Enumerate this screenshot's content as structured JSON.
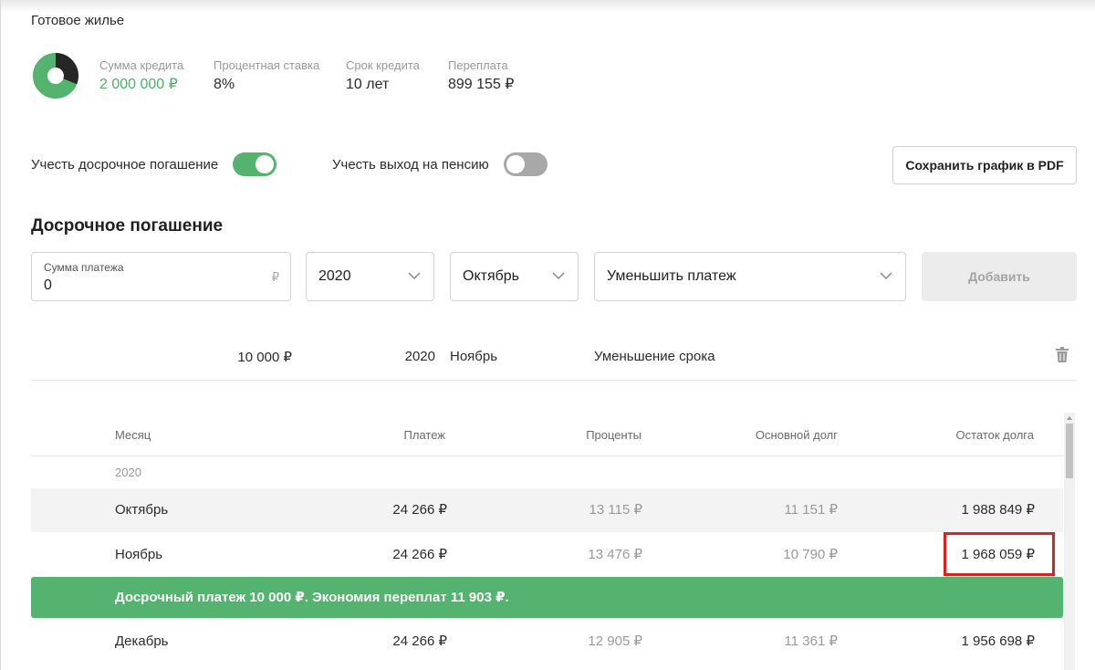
{
  "header": {
    "title": "Готовое жилье"
  },
  "summary": {
    "donut": {
      "credit_fraction": 0.69,
      "overpay_fraction": 0.31,
      "colors": {
        "credit": "#54b36e",
        "overpay": "#262626"
      }
    },
    "stats": [
      {
        "label": "Сумма кредита",
        "value": "2 000 000 ₽"
      },
      {
        "label": "Процентная ставка",
        "value": "8%"
      },
      {
        "label": "Срок кредита",
        "value": "10 лет"
      },
      {
        "label": "Переплата",
        "value": "899 155 ₽"
      }
    ]
  },
  "toggles": {
    "early": {
      "label": "Учесть досрочное погашение",
      "on": true
    },
    "pension": {
      "label": "Учесть выход на пенсию",
      "on": false
    }
  },
  "pdf_button": {
    "label": "Сохранить график в PDF"
  },
  "early_section": {
    "title": "Досрочное погашение",
    "amount_field": {
      "label": "Сумма платежа",
      "value": "0",
      "currency": "₽"
    },
    "year_select": {
      "value": "2020"
    },
    "month_select": {
      "value": "Октябрь"
    },
    "type_select": {
      "value": "Уменьшить платеж"
    },
    "add_button": {
      "label": "Добавить"
    },
    "entry": {
      "amount": "10 000 ₽",
      "year": "2020",
      "month": "Ноябрь",
      "type": "Уменьшение срока"
    }
  },
  "schedule": {
    "columns": [
      "Месяц",
      "Платеж",
      "Проценты",
      "Основной долг",
      "Остаток долга"
    ],
    "year": "2020",
    "rows": [
      {
        "month": "Октябрь",
        "payment": "24 266 ₽",
        "interest": "13 115 ₽",
        "principal": "11 151 ₽",
        "balance": "1 988 849 ₽"
      },
      {
        "month": "Ноябрь",
        "payment": "24 266 ₽",
        "interest": "13 476 ₽",
        "principal": "10 790 ₽",
        "balance": "1 968 059 ₽"
      },
      {
        "month": "Декабрь",
        "payment": "24 266 ₽",
        "interest": "12 905 ₽",
        "principal": "11 361 ₽",
        "balance": "1 956 698 ₽"
      }
    ],
    "banner": "Досрочный платеж 10 000 ₽. Экономия переплат 11 903 ₽."
  },
  "colors": {
    "accent": "#54b36e",
    "highlight": "#e02020"
  }
}
